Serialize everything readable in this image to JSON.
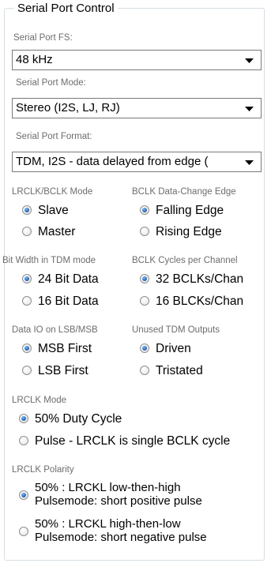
{
  "group": {
    "title": "Serial Port Control"
  },
  "fs": {
    "label": "Serial Port FS:",
    "value": "48 kHz"
  },
  "mode": {
    "label": "Serial Port Mode:",
    "value": "Stereo (I2S, LJ, RJ)"
  },
  "format": {
    "label": "Serial Port Format:",
    "value": "TDM, I2S - data delayed from edge ("
  },
  "lrclk_bclk_mode": {
    "label": "LRCLK/BCLK Mode",
    "options": [
      "Slave",
      "Master"
    ],
    "selected": "Slave"
  },
  "bclk_edge": {
    "label": "BCLK Data-Change Edge",
    "options": [
      "Falling Edge",
      "Rising Edge"
    ],
    "selected": "Falling Edge"
  },
  "bit_width": {
    "label": "Bit Width in TDM mode",
    "options": [
      "24 Bit Data",
      "16 Bit Data"
    ],
    "selected": "24 Bit Data"
  },
  "bclk_cycles": {
    "label": "BCLK Cycles per Channel",
    "options": [
      "32 BCLKs/Chan",
      "16 BLCKs/Chan"
    ],
    "selected": "32 BCLKs/Chan"
  },
  "data_io": {
    "label": "Data IO on LSB/MSB",
    "options": [
      "MSB First",
      "LSB First"
    ],
    "selected": "MSB First"
  },
  "unused_tdm": {
    "label": "Unused TDM Outputs",
    "options": [
      "Driven",
      "Tristated"
    ],
    "selected": "Driven"
  },
  "lrclk_mode": {
    "label": "LRCLK Mode",
    "options": [
      "50% Duty Cycle",
      "Pulse - LRCLK is single BCLK cycle"
    ],
    "selected": "50% Duty Cycle"
  },
  "lrclk_polarity": {
    "label": "LRCLK Polarity",
    "options": [
      {
        "line1": "50% : LRCKL low-then-high",
        "line2": "Pulsemode: short positive pulse"
      },
      {
        "line1": "50% : LRCKL high-then-low",
        "line2": "Pulsemode: short negative pulse"
      }
    ],
    "selected_index": 0
  },
  "icons": {
    "dropdown": "chevron-down-icon",
    "radio": "radio-button-icon"
  }
}
